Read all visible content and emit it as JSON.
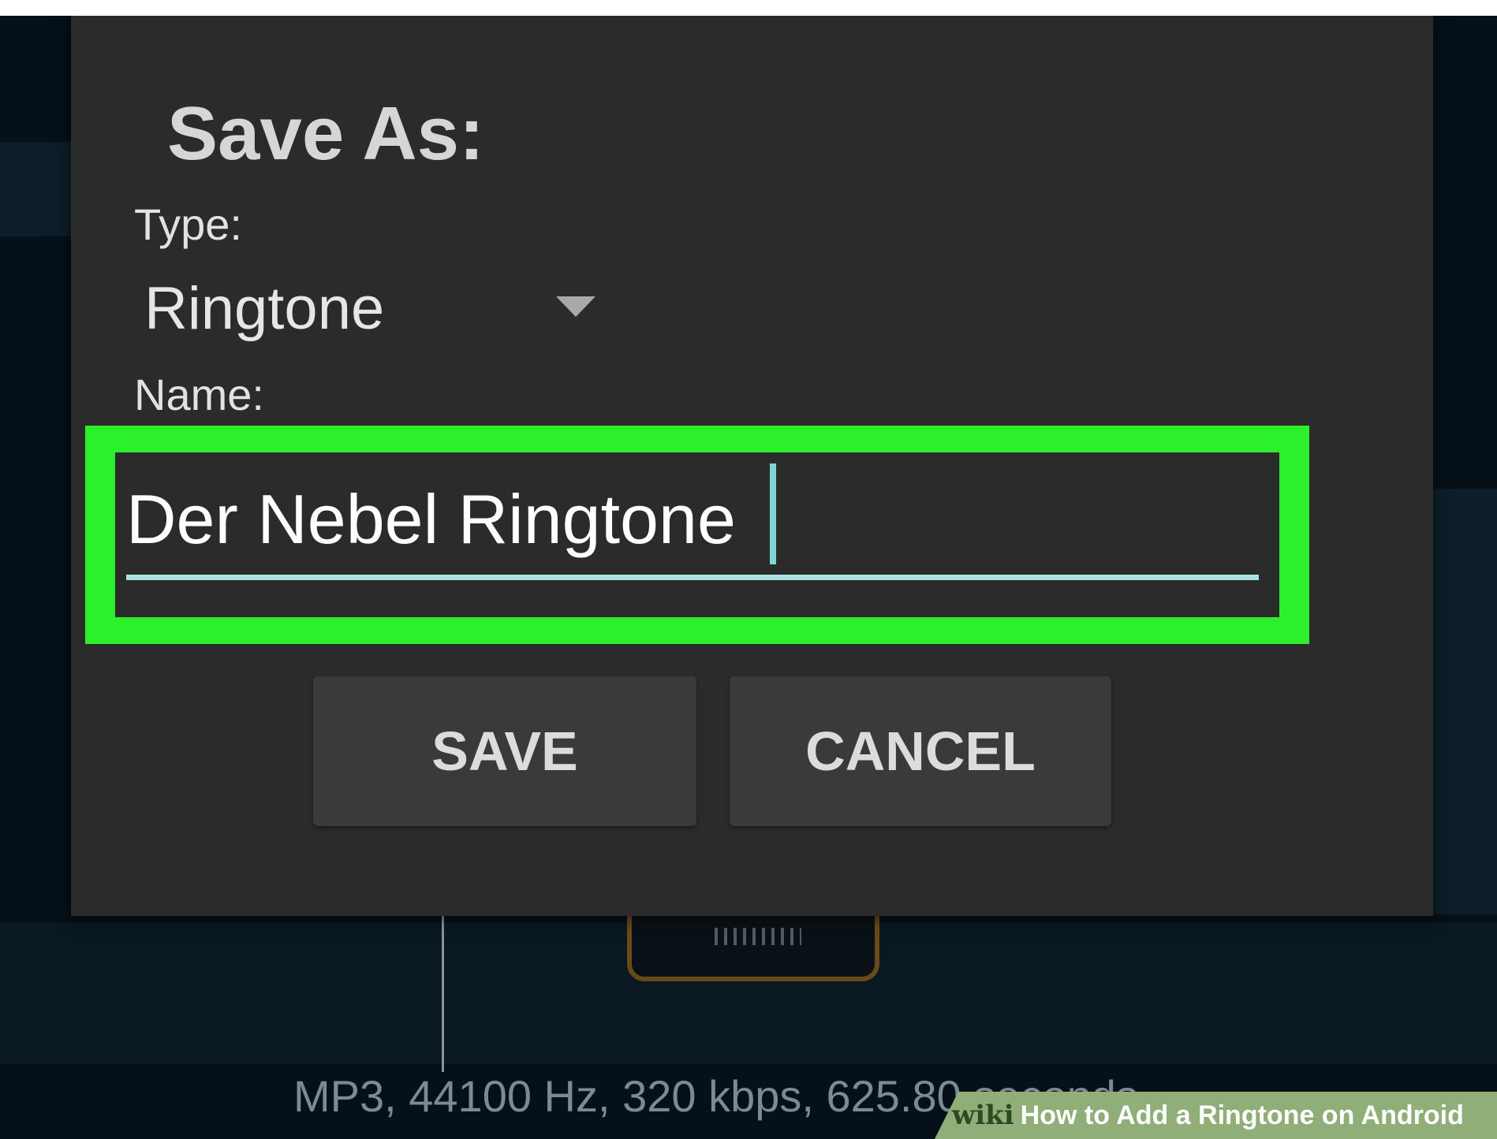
{
  "dialog": {
    "title": "Save As:",
    "type_label": "Type:",
    "type_value": "Ringtone",
    "name_label": "Name:",
    "name_value": "Der Nebel Ringtone",
    "save_label": "SAVE",
    "cancel_label": "CANCEL"
  },
  "background": {
    "audio_info": "MP3, 44100 Hz, 320 kbps, 625.80 seconds"
  },
  "watermark": {
    "brand": "wiki",
    "title": "How to Add a Ringtone on Android"
  },
  "colors": {
    "highlight": "#2cf02c",
    "dialog_bg": "#2b2b2b",
    "accent_cursor": "#7fd4d4",
    "backdrop": "#061018"
  },
  "icons": {
    "dropdown": "triangle-down"
  }
}
